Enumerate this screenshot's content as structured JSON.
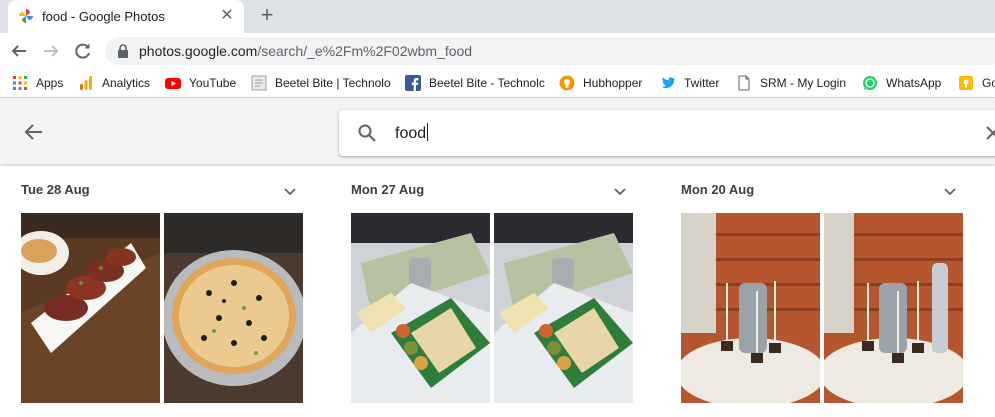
{
  "browser": {
    "tab": {
      "title": "food - Google Photos",
      "close_icon": "close-icon"
    },
    "new_tab_icon": "plus-icon",
    "url_host": "photos.google.com",
    "url_path": "/search/_e%2Fm%2F02wbm_food"
  },
  "bookmarks": [
    {
      "label": "Apps",
      "icon": "apps-grid-icon"
    },
    {
      "label": "Analytics",
      "icon": "analytics-icon"
    },
    {
      "label": "YouTube",
      "icon": "youtube-icon"
    },
    {
      "label": "Beetel Bite | Technolo",
      "icon": "page-favicon-icon"
    },
    {
      "label": "Beetel Bite - Technolc",
      "icon": "facebook-icon"
    },
    {
      "label": "Hubhopper",
      "icon": "hubhopper-icon"
    },
    {
      "label": "Twitter",
      "icon": "twitter-icon"
    },
    {
      "label": "SRM - My Login",
      "icon": "document-icon"
    },
    {
      "label": "WhatsApp",
      "icon": "whatsapp-icon"
    },
    {
      "label": "Go",
      "icon": "keep-icon"
    }
  ],
  "search": {
    "query": "food"
  },
  "groups": [
    {
      "date": "Tue 28 Aug",
      "photos": [
        "kebab-plate-photo",
        "pizza-photo"
      ]
    },
    {
      "date": "Mon 27 Aug",
      "photos": [
        "dosa-thali-photo",
        "dosa-thali-photo-2"
      ]
    },
    {
      "date": "Mon 20 Aug",
      "photos": [
        "drink-tray-photo",
        "drink-tray-photo-2"
      ]
    }
  ],
  "colors": {
    "tabstrip": "#dee1e6",
    "header_bg": "#f1f3f4",
    "text": "#202124"
  }
}
